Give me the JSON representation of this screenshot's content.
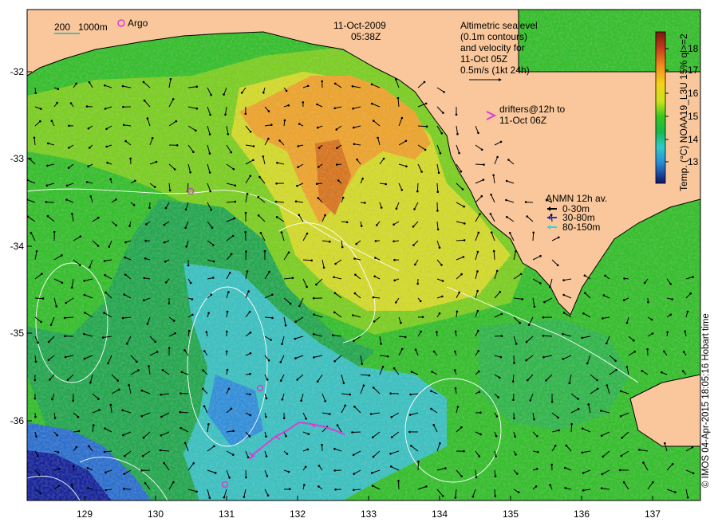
{
  "header": {
    "date": "11-Oct-2009",
    "time": "05:38Z"
  },
  "scale_legend": {
    "label_200": "200",
    "label_1000": "1000m",
    "argo_label": "Argo"
  },
  "info_box": {
    "line1": "Altimetric sealevel",
    "line2": "(0.1m contours)",
    "line3": "and velocity for",
    "line4": "11-Oct 05Z",
    "line5": "0.5m/s (1kt 24h)"
  },
  "drifters": {
    "line1": "drifters@12h to",
    "line2": "11-Oct 06Z"
  },
  "anmn": {
    "title": "ANMN 12h av.",
    "items": [
      {
        "label": "0-30m",
        "color": "#000000"
      },
      {
        "label": "30-80m",
        "color": "#1f2fd6"
      },
      {
        "label": "80-150m",
        "color": "#35d5d5"
      }
    ]
  },
  "colorbar": {
    "title": "Temp. (°C) NOAA19_L3U 15% ql>=2",
    "ticks": [
      "18",
      "17",
      "16",
      "15",
      "14",
      "13"
    ]
  },
  "axes": {
    "y_ticks": [
      "-32",
      "-33",
      "-34",
      "-35",
      "-36"
    ],
    "x_ticks": [
      "129",
      "130",
      "131",
      "132",
      "133",
      "134",
      "135",
      "136",
      "137"
    ]
  },
  "credit": "© IMOS 04-Apr-2015 18:05:16 Hobart time",
  "colors": {
    "land": "#f9c79b",
    "argo": "#d63fd6",
    "drifter": "#d63fd6",
    "contour": "#ffffff"
  }
}
